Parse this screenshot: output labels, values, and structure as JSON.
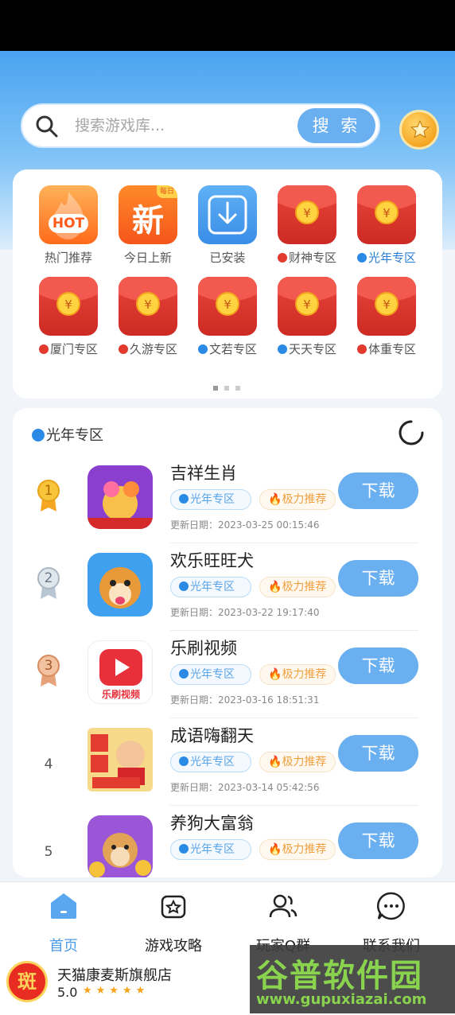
{
  "search": {
    "placeholder": "搜索游戏库...",
    "button_label": "搜 索"
  },
  "categories": [
    {
      "label": "热门推荐",
      "icon": "hot-fire-icon",
      "tile_text": "HOT"
    },
    {
      "label": "今日上新",
      "icon": "new-icon",
      "tile_text": "新",
      "corner_text": "每日"
    },
    {
      "label": "已安装",
      "icon": "download-tray-icon"
    },
    {
      "label": "财神专区",
      "icon": "red-envelope-icon",
      "dot": "red"
    },
    {
      "label": "光年专区",
      "icon": "red-envelope-icon",
      "dot": "blue"
    },
    {
      "label": "厦门专区",
      "icon": "red-envelope-icon",
      "dot": "red"
    },
    {
      "label": "久游专区",
      "icon": "red-envelope-icon",
      "dot": "red"
    },
    {
      "label": "文若专区",
      "icon": "red-envelope-icon",
      "dot": "blue"
    },
    {
      "label": "天天专区",
      "icon": "red-envelope-icon",
      "dot": "blue"
    },
    {
      "label": "体重专区",
      "icon": "red-envelope-icon",
      "dot": "red"
    }
  ],
  "list": {
    "title": "光年专区",
    "items": [
      {
        "rank": "1",
        "name": "吉祥生肖",
        "zone_tag": "光年专区",
        "rec_tag": "极力推荐",
        "update": "更新日期：2023-03-25 00:15:46",
        "button": "下载",
        "medal": "gold"
      },
      {
        "rank": "2",
        "name": "欢乐旺旺犬",
        "zone_tag": "光年专区",
        "rec_tag": "极力推荐",
        "update": "更新日期：2023-03-22 19:17:40",
        "button": "下载",
        "medal": "silver"
      },
      {
        "rank": "3",
        "name": "乐刷视频",
        "zone_tag": "光年专区",
        "rec_tag": "极力推荐",
        "update": "更新日期：2023-03-16 18:51:31",
        "button": "下载",
        "medal": "bronze",
        "icon_caption": "乐刷视频"
      },
      {
        "rank": "4",
        "name": "成语嗨翻天",
        "zone_tag": "光年专区",
        "rec_tag": "极力推荐",
        "update": "更新日期：2023-03-14 05:42:56",
        "button": "下载"
      },
      {
        "rank": "5",
        "name": "养狗大富翁",
        "zone_tag": "光年专区",
        "rec_tag": "极力推荐",
        "update": "",
        "button": "下载"
      }
    ]
  },
  "tabs": [
    {
      "label": "首页",
      "icon": "home-icon",
      "active": true
    },
    {
      "label": "游戏攻略",
      "icon": "strategy-icon",
      "active": false
    },
    {
      "label": "玩家Q群",
      "icon": "group-icon",
      "active": false
    },
    {
      "label": "联系我们",
      "icon": "chat-icon",
      "active": false
    }
  ],
  "store": {
    "logo_text": "斑",
    "name": "天猫康麦斯旗舰店",
    "rating": "5.0",
    "stars": "★★★★★"
  },
  "watermark": {
    "title": "谷普软件园",
    "url": "www.gupuxiazai.com"
  },
  "colors": {
    "accent": "#6aaff0",
    "tab_active": "#4a9be8",
    "red_envelope": "#e2372e",
    "tag_orange": "#f0a040"
  }
}
